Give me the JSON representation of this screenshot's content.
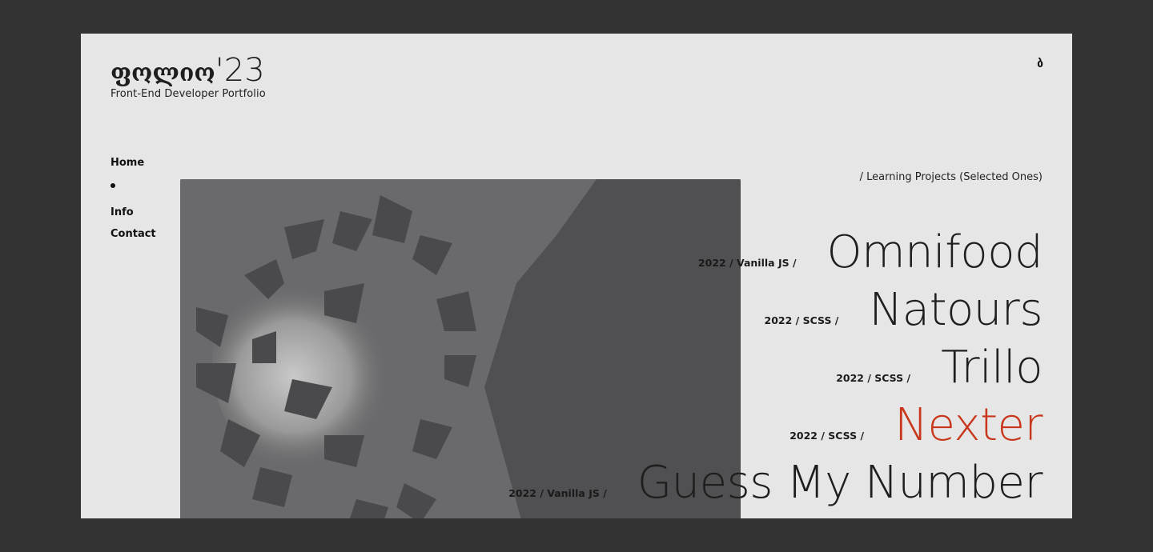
{
  "header": {
    "logo_name": "ფოლიო",
    "logo_year": "'23",
    "subtitle": "Front-End Developer Portfolio",
    "lang_toggle": "ბ"
  },
  "nav": {
    "items": [
      {
        "label": "Home"
      },
      {
        "label": "Info"
      },
      {
        "label": "Contact"
      }
    ]
  },
  "section": {
    "label": "/ Learning Projects (Selected Ones)"
  },
  "projects": [
    {
      "name": "Omnifood",
      "meta": "2022 / Vanilla JS /",
      "active": false
    },
    {
      "name": "Natours",
      "meta": "2022 / SCSS /",
      "active": false
    },
    {
      "name": "Trillo",
      "meta": "2022 / SCSS /",
      "active": false
    },
    {
      "name": "Nexter",
      "meta": "2022 / SCSS /",
      "active": true
    },
    {
      "name": "Guess My Number",
      "meta": "2022 / Vanilla JS /",
      "active": false
    }
  ],
  "colors": {
    "background": "#333333",
    "card": "#e6e6e6",
    "accent": "#c8371b",
    "text": "#1e1e1e"
  },
  "image": {
    "subject": "butterflies-photo"
  }
}
